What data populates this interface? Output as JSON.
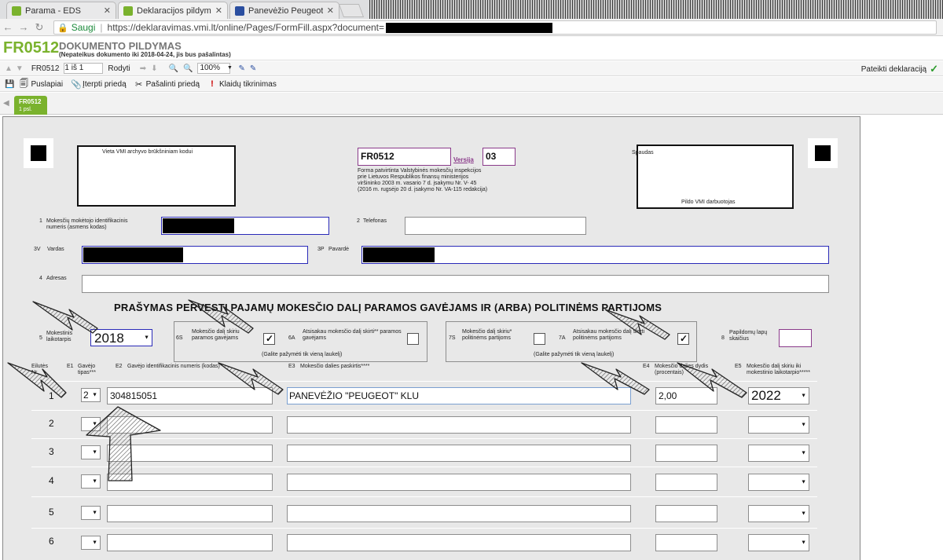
{
  "browser": {
    "tabs": [
      {
        "label": "Parama - EDS",
        "favicon_color": "#7ab22d"
      },
      {
        "label": "Deklaracijos pildymas - E",
        "favicon_color": "#7ab22d"
      },
      {
        "label": "Panevėžio Peugeot klub",
        "favicon_color": "#2a4ea0"
      }
    ],
    "secure_label": "Saugi",
    "url": "https://deklaravimas.vmi.lt/online/Pages/FormFill.aspx?document="
  },
  "app": {
    "form_code": "FR0512",
    "title": "DOKUMENTO PILDYMAS",
    "note": "(Nepateikus dokumento iki 2018-04-24, jis bus pašalintas)",
    "toolbar": {
      "doc": "FR0512",
      "page": "1 iš 1",
      "show": "Rodyti",
      "zoom": "100%",
      "submit": "Pateikti deklaraciją",
      "pages": "Puslapiai",
      "insert_attachment": "Įterpti priedą",
      "remove_attachment": "Pašalinti priedą",
      "check_errors": "Klaidų tikrinimas"
    },
    "doc_tab": {
      "code": "FR0512",
      "page": "1 psl."
    }
  },
  "form": {
    "archive_label": "Vieta VMI archyvo brūkšniniam kodui",
    "form_code": "FR0512",
    "version_label": "Versija",
    "version": "03",
    "approval": [
      "Forma patvirtinta Valstybinės mokesčių inspekcijos",
      "prie Lietuvos Respublikos finansų ministerijos",
      "viršininko 2003 m. vasario 7 d. įsakymu Nr. V- 45",
      "(2016 m. rugsėjo 20 d. įsakymo Nr. VA-115 redakcija)"
    ],
    "stamp_label": "Spaudas",
    "filled_by": "Pildo VMI darbuotojas",
    "f1_num": "1",
    "f1_label": [
      "Mokesčių mokėtojo identifikacinis",
      "numeris (asmens kodas)"
    ],
    "f2_num": "2",
    "f2_label": "Telefonas",
    "f3v_num": "3V",
    "f3v_label": "Vardas",
    "f3p_num": "3P",
    "f3p_label": "Pavardė",
    "f4_num": "4",
    "f4_label": "Adresas",
    "heading": "PRAŠYMAS PERVESTI PAJAMŲ MOKESČIO DALĮ PARAMOS GAVĖJAMS IR (ARBA) POLITINĖMS PARTIJOMS",
    "f5_num": "5",
    "f5_label": [
      "Mokestinis",
      "laikotarpis"
    ],
    "f5_value": "2018",
    "f6s_num": "6S",
    "f6s_label": [
      "Mokesčio dalį skiriu",
      "paramos gavėjams"
    ],
    "f6s_checked": true,
    "f6a_num": "6A",
    "f6a_label": [
      "Atsisakau mokesčio dalį skirti** paramos",
      "gavėjams"
    ],
    "f6a_checked": false,
    "grp_note": "(Galite pažymėti tik vieną laukelį)",
    "f7s_num": "7S",
    "f7s_label": [
      "Mokesčio dalį skiriu*",
      "politinėms partijoms"
    ],
    "f7s_checked": false,
    "f7a_num": "7A",
    "f7a_label": [
      "Atsisakau mokesčio dalį skirti",
      "politinėms partijoms"
    ],
    "f7a_checked": true,
    "f8_num": "8",
    "f8_label": [
      "Papildomų lapų",
      "skaičius"
    ],
    "columns": {
      "row": [
        "Eilutės",
        "Nr."
      ],
      "e1_num": "E1",
      "e1": [
        "Gavėjo",
        "tipas***"
      ],
      "e2_num": "E2",
      "e2": "Gavėjo identifikacinis numeris (kodas)",
      "e3_num": "E3",
      "e3": "Mokesčio dalies paskirtis****",
      "e4_num": "E4",
      "e4": [
        "Mokesčio dalies dydis",
        "(procentais)"
      ],
      "e5_num": "E5",
      "e5": [
        "Mokesčio dalį skiriu iki",
        "mokestinio laikotarpio*****"
      ]
    },
    "rows": [
      {
        "nr": "1",
        "type": "2",
        "code": "304815051",
        "purpose": "PANEVĖŽIO \"PEUGEOT\" KLU",
        "size": "2,00",
        "until": "2022"
      },
      {
        "nr": "2",
        "type": "",
        "code": "",
        "purpose": "",
        "size": "",
        "until": ""
      },
      {
        "nr": "3",
        "type": "",
        "code": "",
        "purpose": "",
        "size": "",
        "until": ""
      },
      {
        "nr": "4",
        "type": "",
        "code": "",
        "purpose": "",
        "size": "",
        "until": ""
      },
      {
        "nr": "5",
        "type": "",
        "code": "",
        "purpose": "",
        "size": "",
        "until": ""
      },
      {
        "nr": "6",
        "type": "",
        "code": "",
        "purpose": "",
        "size": "",
        "until": ""
      }
    ]
  }
}
